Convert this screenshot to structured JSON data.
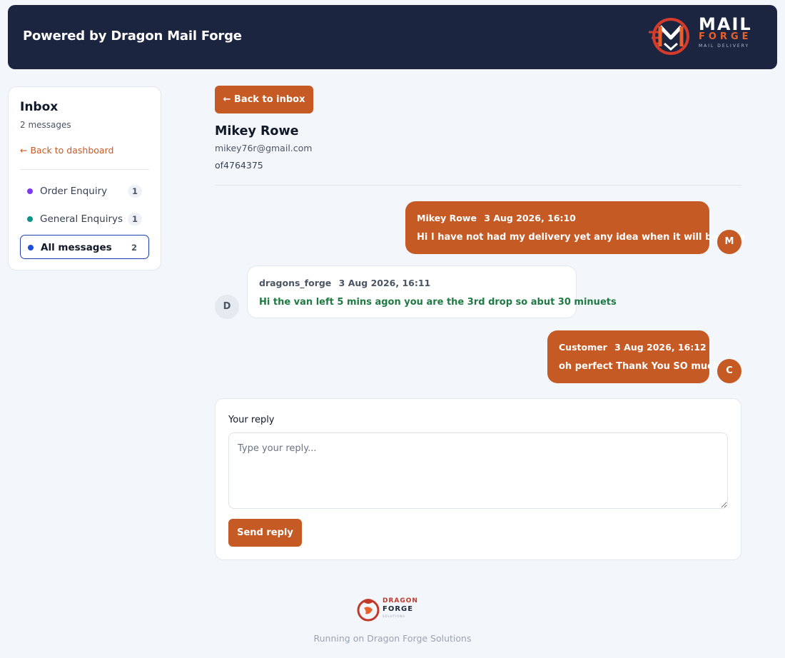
{
  "header": {
    "title": "Powered by Dragon Mail Forge",
    "logo": {
      "line1": "MAIL",
      "line2": "FORGE",
      "line3": "MAIL DELIVERY",
      "icon": "mail-forge-logo-icon"
    }
  },
  "sidebar": {
    "title": "Inbox",
    "count_text": "2 messages",
    "back_label": "← Back to dashboard",
    "folders": [
      {
        "label": "Order Enquiry",
        "count": "1",
        "color": "#7c3aed",
        "active": false
      },
      {
        "label": "General Enquirys",
        "count": "1",
        "color": "#0d9488",
        "active": false
      },
      {
        "label": "All messages",
        "count": "2",
        "color": "#1d4ed8",
        "active": true
      }
    ]
  },
  "thread": {
    "back_label": "← Back to inbox",
    "contact": {
      "name": "Mikey Rowe",
      "email": "mikey76r@gmail.com",
      "reference": "of4764375"
    },
    "messages": [
      {
        "author": "Mikey Rowe",
        "time": "3 Aug 2026, 16:10",
        "text": "Hi I have not had my delivery yet any idea when it will be here",
        "direction": "outgoing",
        "avatar": "M"
      },
      {
        "author": "dragons_forge",
        "time": "3 Aug 2026, 16:11",
        "text": "Hi the van left 5 mins agon you are the 3rd drop so abut 30 minuets",
        "direction": "incoming",
        "avatar": "D"
      },
      {
        "author": "Customer",
        "time": "3 Aug 2026, 16:12",
        "text": "oh perfect Thank You SO much",
        "direction": "outgoing",
        "avatar": "C"
      }
    ]
  },
  "reply": {
    "label": "Your reply",
    "value": "",
    "placeholder": "Type your reply...",
    "send_label": "Send reply"
  },
  "footer": {
    "logo": {
      "line1": "DRAGON",
      "line2": "FORGE",
      "line3": "SOLUTIONS",
      "icon": "dragon-forge-logo-icon"
    },
    "text": "Running on Dragon Forge Solutions"
  },
  "colors": {
    "accent": "#c65a24",
    "header_bg": "#1c2540",
    "incoming_text": "#1f7a44",
    "active_border": "#1e40af"
  }
}
